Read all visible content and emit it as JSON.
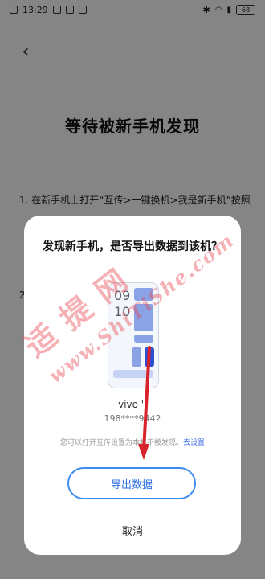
{
  "status_bar": {
    "time": "13:29",
    "icons": [
      "image-icon",
      "notification-icon",
      "app-icon",
      "message-icon"
    ],
    "right_icons": [
      "bluetooth-icon",
      "wifi-icon",
      "signal-icon"
    ],
    "battery": "68"
  },
  "header": {
    "back_icon": "chevron-left-icon",
    "title": "等待被新手机发现"
  },
  "background_steps": {
    "step1_text": "1. 在新手机上打开“互传>一键换机>我是新手机”按照",
    "step2_text": "2"
  },
  "dialog": {
    "title": "发现新手机，是否导出数据到该机？",
    "phone_preview": {
      "clock_top": "09",
      "clock_bottom": "10"
    },
    "device_name": "vivo ',",
    "device_id": "198****9442",
    "hint_text": "您可以打开互传设置为本机不被发现。",
    "hint_link": "去设置",
    "export_label": "导出数据",
    "cancel_label": "取消"
  },
  "watermark": {
    "text": "适 提 网",
    "sub": "www.ShiTiShe.com"
  },
  "colors": {
    "accent": "#3e8bf0",
    "link": "#3d6ee8",
    "watermark": "#e84650",
    "arrow": "#d8232a"
  }
}
